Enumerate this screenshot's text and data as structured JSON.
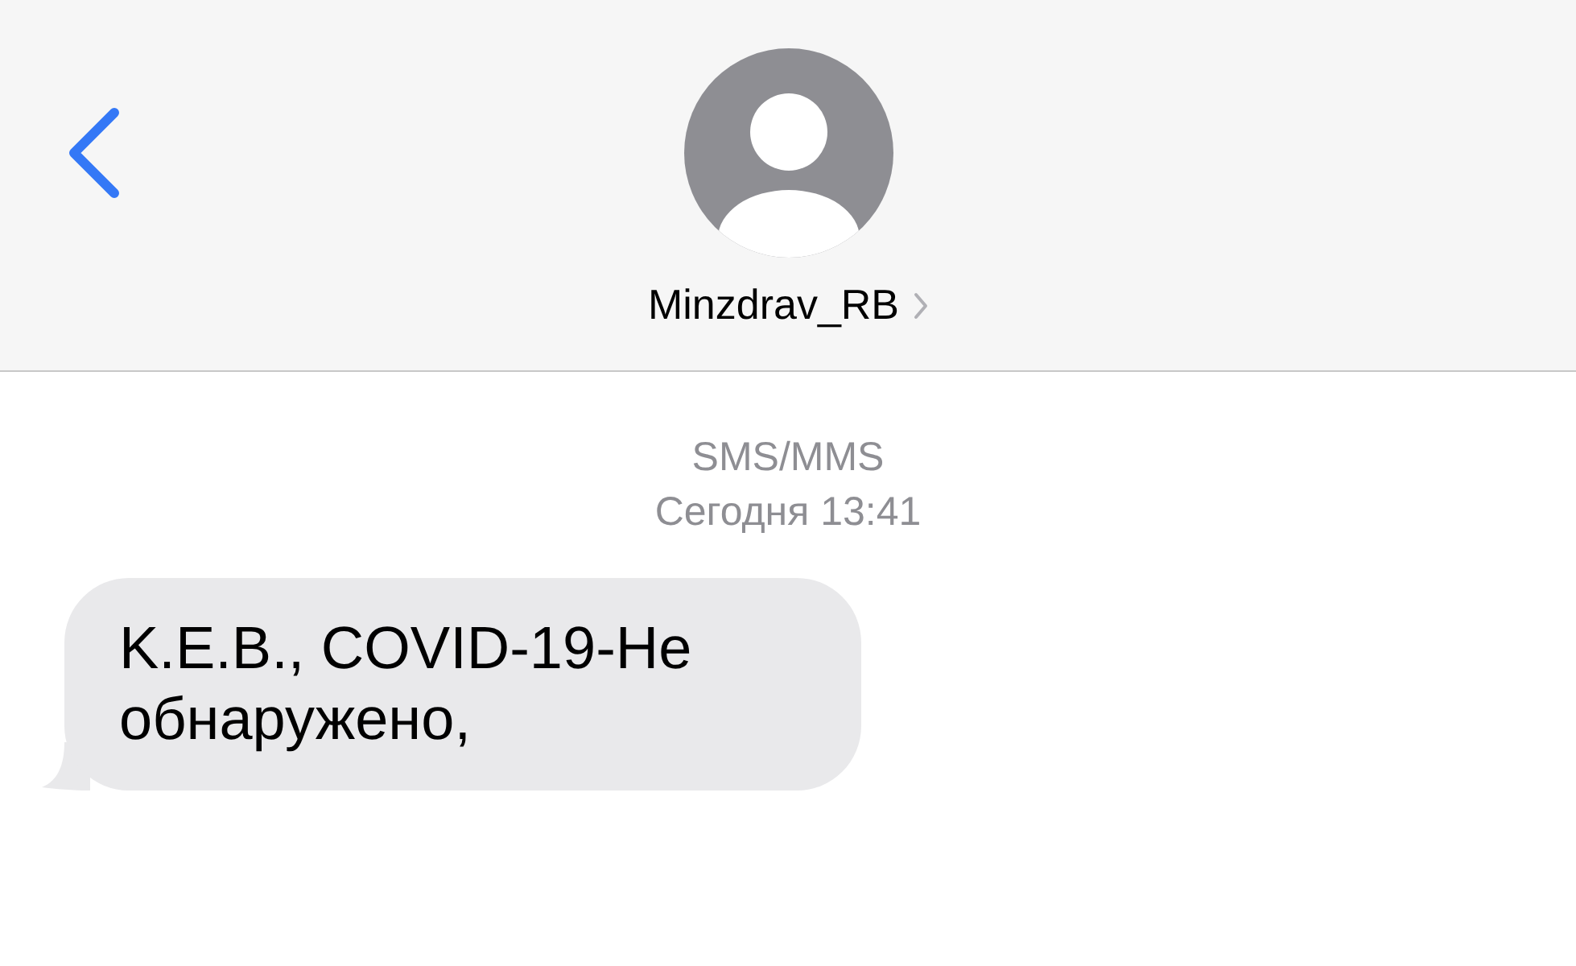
{
  "header": {
    "contact_name": "Minzdrav_RB"
  },
  "conversation": {
    "service": "SMS/MMS",
    "timestamp": "Сегодня 13:41",
    "messages": [
      {
        "text": "K.E.B., COVID-19-Не обнаружено,",
        "kind": "incoming"
      }
    ]
  }
}
